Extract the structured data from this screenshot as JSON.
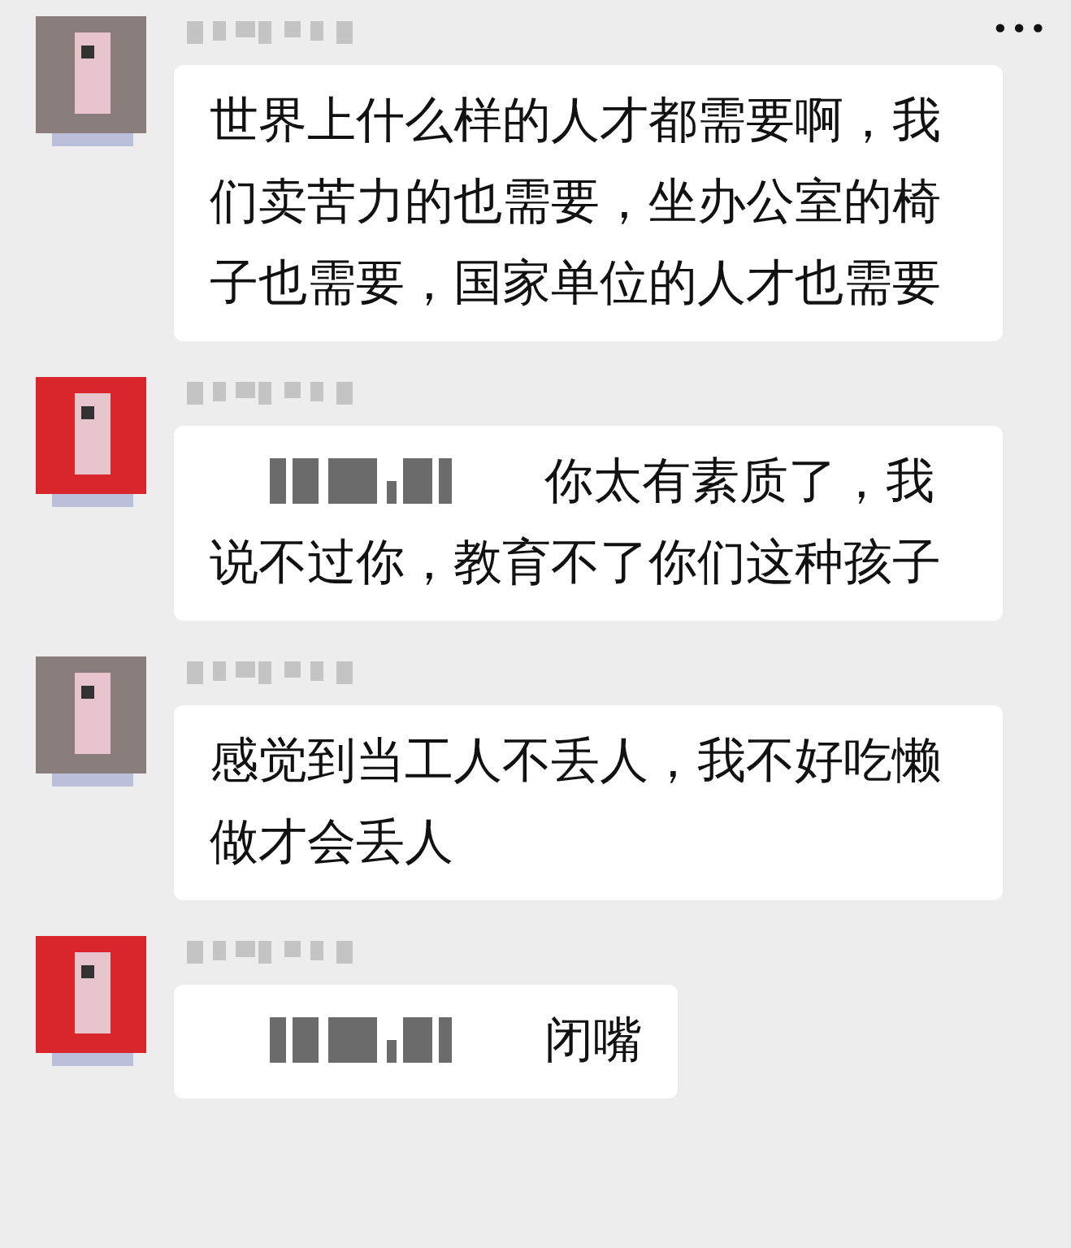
{
  "more_button": "•••",
  "messages": [
    {
      "color": "#8a7e7c",
      "redacted_prefix": false,
      "text": "世界上什么样的人才都需要啊，我们卖苦力的也需要，坐办公室的椅子也需要，国家单位的人才也需要"
    },
    {
      "color": "#d8262c",
      "redacted_prefix": true,
      "text": "你太有素质了，我说不过你，教育不了你们这种孩子"
    },
    {
      "color": "#8a7e7c",
      "redacted_prefix": false,
      "text": "感觉到当工人不丢人，我不好吃懒做才会丢人"
    },
    {
      "color": "#d8262c",
      "redacted_prefix": true,
      "text": "闭嘴"
    }
  ]
}
